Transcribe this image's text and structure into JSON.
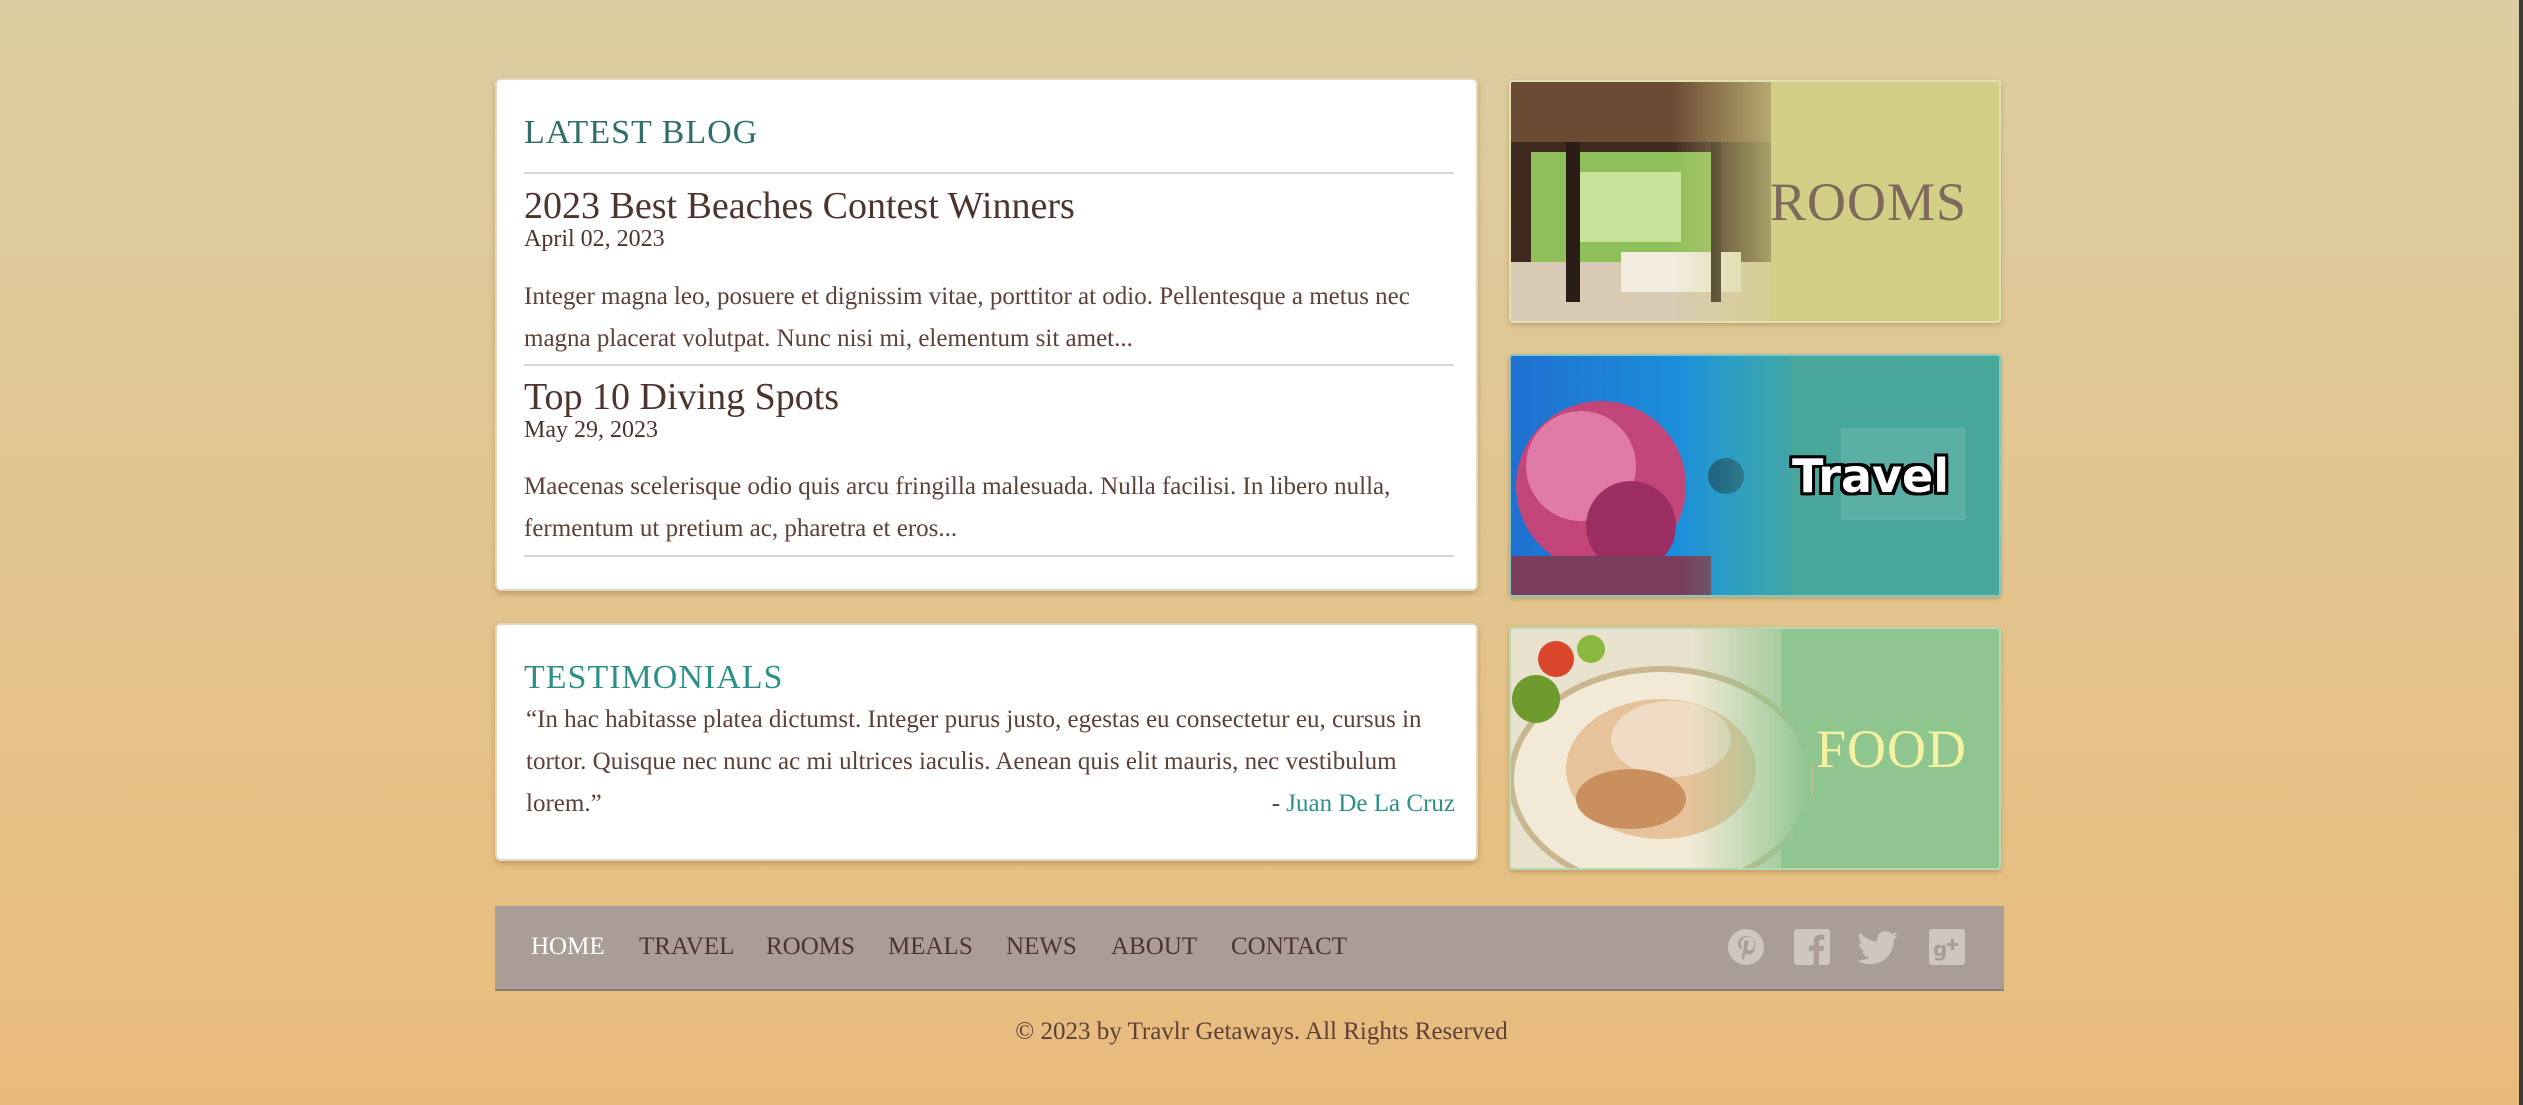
{
  "blog": {
    "title": "LATEST BLOG",
    "posts": [
      {
        "title": "2023 Best Beaches Contest Winners",
        "date": "April 02, 2023",
        "excerpt": "Integer magna leo, posuere et dignissim vitae, porttitor at odio. Pellentesque a metus nec magna placerat volutpat. Nunc nisi mi, elementum sit amet..."
      },
      {
        "title": "Top 10 Diving Spots",
        "date": "May 29, 2023",
        "excerpt": "Maecenas scelerisque odio quis arcu fringilla malesuada. Nulla facilisi. In libero nulla, fermentum ut pretium ac, pharetra et eros..."
      }
    ]
  },
  "testimonials": {
    "title": "TESTIMONIALS",
    "quote": "“In hac habitasse platea dictumst. Integer purus justo, egestas eu consectetur eu, cursus in tortor. Quisque nec nunc ac mi ultrices iaculis. Aenean quis elit mauris, nec vestibulum lorem.”",
    "author_prefix": "- ",
    "author": "Juan De La Cruz"
  },
  "promos": [
    {
      "label": "ROOMS",
      "color": "#d4cf86"
    },
    {
      "label": "Travel",
      "color": "#49a69b"
    },
    {
      "label": "FOOD",
      "color": "#8fc68f"
    }
  ],
  "nav": {
    "items": [
      "HOME",
      "TRAVEL",
      "ROOMS",
      "MEALS",
      "NEWS",
      "ABOUT",
      "CONTACT"
    ],
    "active": "HOME",
    "social_icons": [
      "pinterest-icon",
      "facebook-icon",
      "twitter-icon",
      "google-plus-icon"
    ]
  },
  "footer": {
    "copyright": "© 2023 by Travlr Getaways. All Rights Reserved"
  },
  "colors": {
    "accent_teal": "#2c9089",
    "text_brown": "#4e342e",
    "nav_background": "#aa9d95"
  }
}
